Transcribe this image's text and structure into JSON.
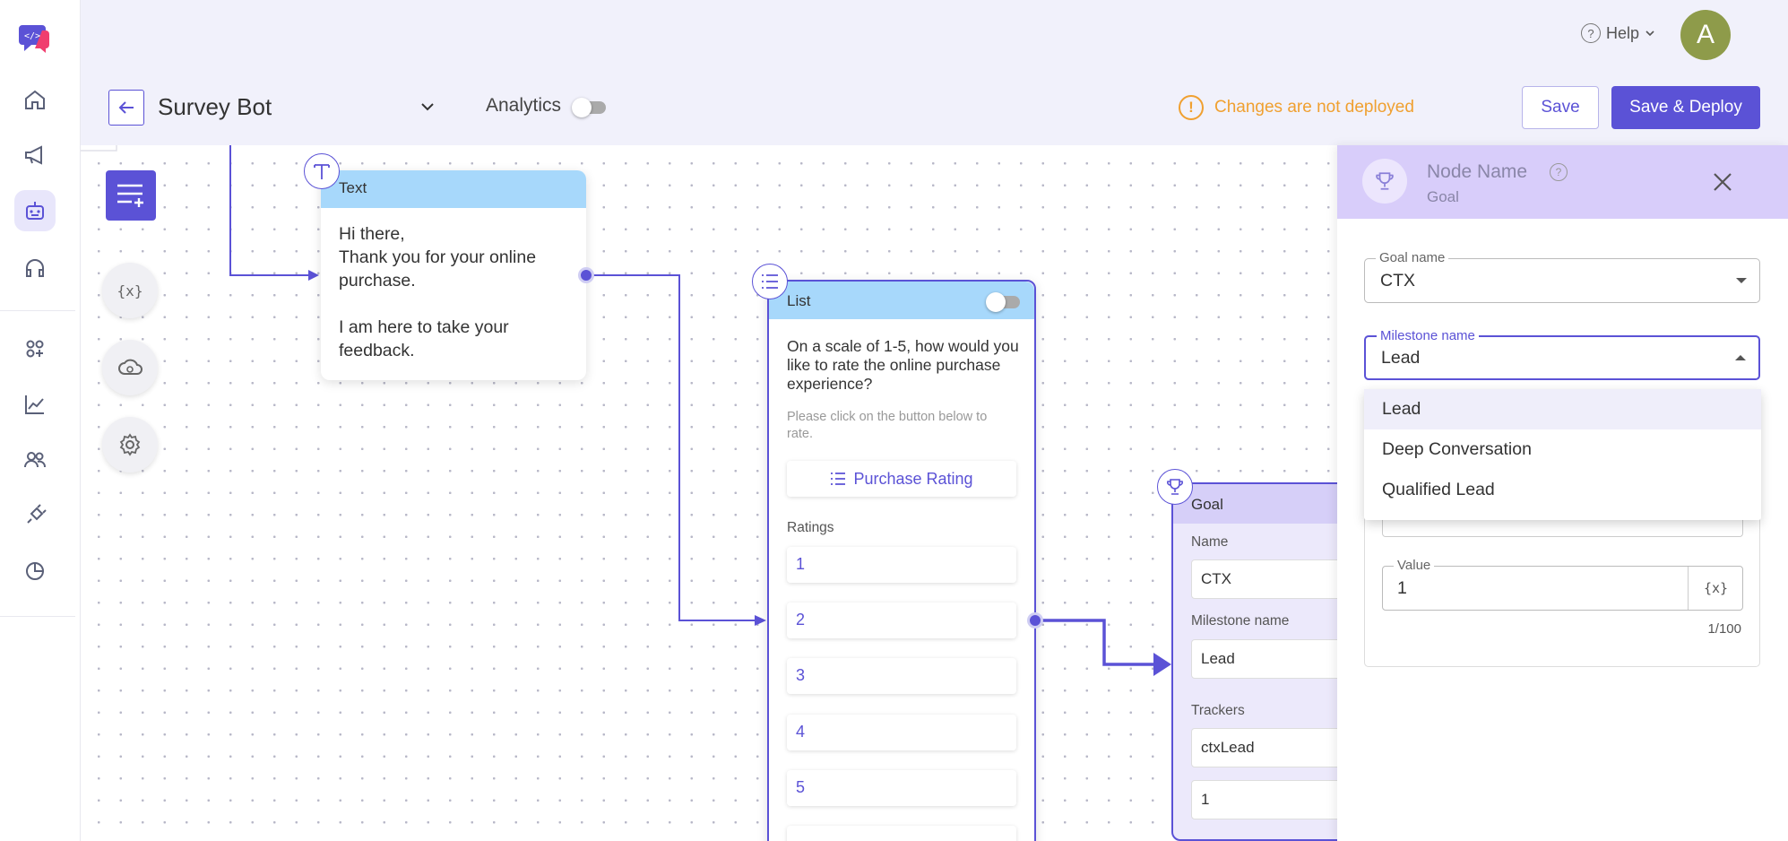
{
  "header": {
    "help_label": "Help",
    "help_q": "?",
    "avatar_letter": "A",
    "bot_name": "Survey Bot",
    "analytics_label": "Analytics",
    "warning_text": "Changes are not deployed",
    "warning_mark": "!",
    "save_label": "Save",
    "deploy_label": "Save & Deploy"
  },
  "text_node": {
    "title": "Text",
    "line1": "Hi there,",
    "line2": "Thank you for your online",
    "line3": "purchase.",
    "line4": "I am here to take your",
    "line5": "feedback."
  },
  "list_node": {
    "title": "List",
    "question": "On a scale of 1-5, how would you like to rate the online purchase experience?",
    "hint": "Please click on the button below to rate.",
    "button_label": "Purchase Rating",
    "ratings_label": "Ratings",
    "options": [
      "1",
      "2",
      "3",
      "4",
      "5"
    ]
  },
  "goal_node": {
    "title": "Goal",
    "name_label": "Name",
    "name_value": "CTX",
    "milestone_label": "Milestone name",
    "milestone_value": "Lead",
    "trackers_label": "Trackers",
    "tracker_value": "ctxLead",
    "tracker_num": "1"
  },
  "panel": {
    "title": "Node Name",
    "q": "?",
    "subtitle": "Goal",
    "goal_name_label": "Goal name",
    "goal_name_value": "CTX",
    "milestone_label": "Milestone name",
    "milestone_value": "Lead",
    "dropdown_options": [
      "Lead",
      "Deep Conversation",
      "Qualified Lead"
    ],
    "value_label": "Value",
    "value_value": "1",
    "counter": "1/100",
    "var_icon": "{x}"
  },
  "toolbar": {
    "variables_icon": "{x}"
  },
  "colors": {
    "accent": "#5b52d6",
    "warning": "#f0a030",
    "node_head_blue": "#a7d8fb",
    "goal_head": "#d6cff8"
  }
}
